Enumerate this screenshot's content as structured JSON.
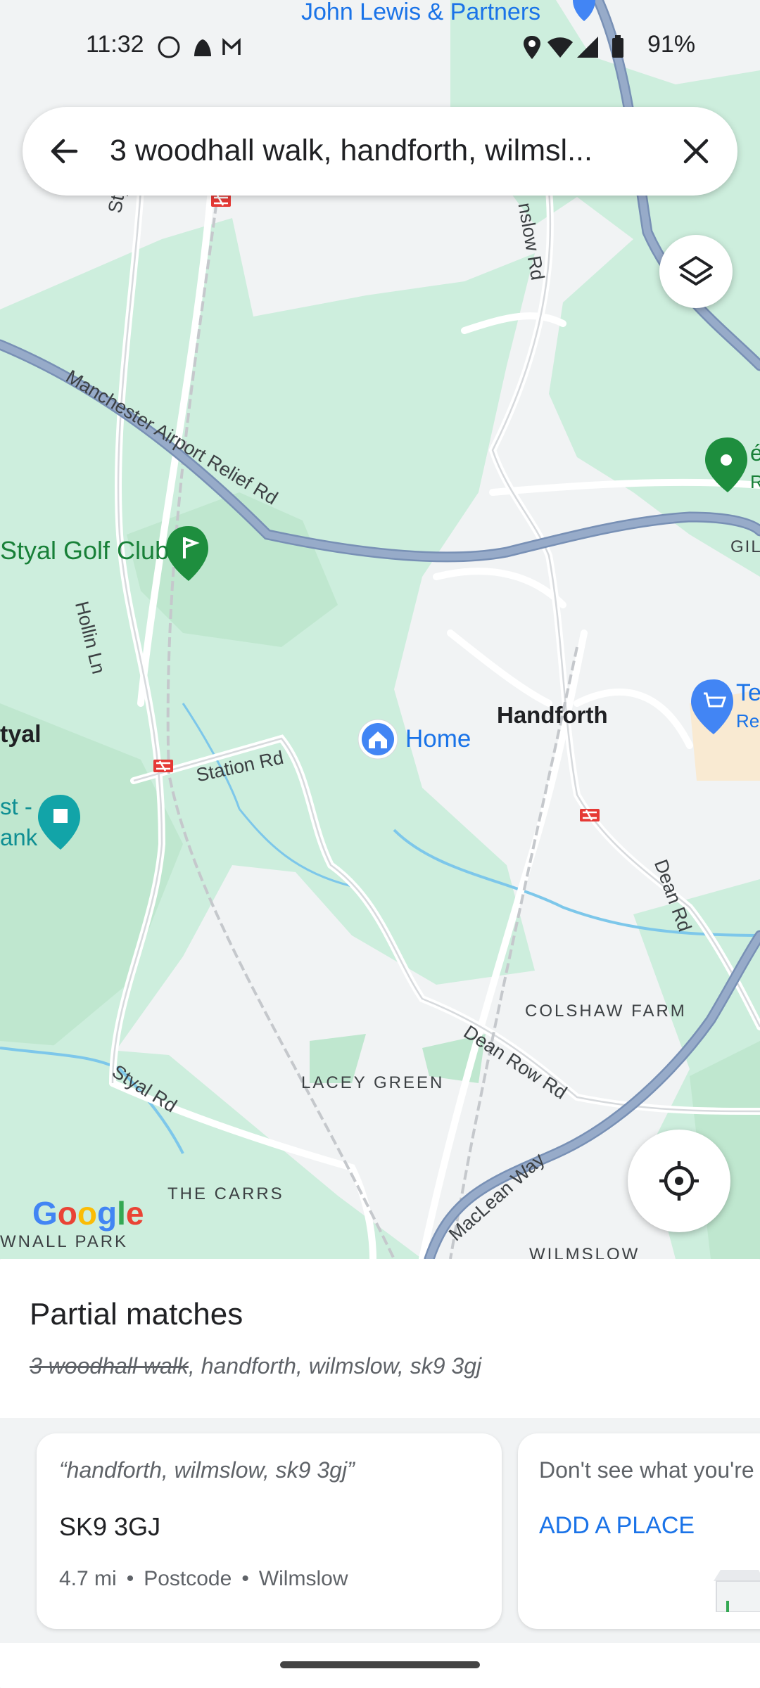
{
  "status_bar": {
    "time": "11:32",
    "battery": "91%",
    "notification_icons": [
      "whatsapp-icon",
      "snapchat-icon",
      "gmail-icon"
    ],
    "system_icons": [
      "location-icon",
      "wifi-icon",
      "signal-icon",
      "battery-icon"
    ]
  },
  "search": {
    "query": "3 woodhall walk, handforth, wilmsl..."
  },
  "map": {
    "places": {
      "top_store": "John Lewis & Partners",
      "golf": "Styal Golf Club",
      "home": "Home",
      "town": "Handforth",
      "styal": "tyal",
      "trust_line1": "st -",
      "trust_line2": "ank",
      "tesco_line1": "Te",
      "tesco_line2": "Re",
      "right_pin_line1": "é",
      "right_pin_line2": "R",
      "gil": "GIL"
    },
    "roads": {
      "styal_rd_top": "Styal Rd",
      "wilmslow_rd": "nslow Rd",
      "airport_relief": "Manchester Airport Relief Rd",
      "hollin_ln": "Hollin Ln",
      "station_rd": "Station Rd",
      "dean_rd": "Dean Rd",
      "dean_row_rd": "Dean Row Rd",
      "styal_rd_bottom": "Styal Rd",
      "maclean_way": "MacLean Way"
    },
    "areas": {
      "colshaw_farm": "COLSHAW FARM",
      "lacey_green": "LACEY GREEN",
      "the_carrs": "THE CARRS",
      "wilmslow": "WILMSLOW",
      "wnall_park": "WNALL PARK"
    },
    "logo": "Google",
    "colors": {
      "land": "#f1f3f4",
      "park": "#cdeedd",
      "park_dark": "#bfe7cf",
      "motorway": "#8a9fbf",
      "water": "#7dc7ea",
      "pin_green": "#1e8e3e",
      "pin_blue": "#4285f4"
    }
  },
  "sheet": {
    "title": "Partial matches",
    "sub_strike": "3 woodhall walk",
    "sub_rest": ", handforth, wilmslow, sk9 3gj"
  },
  "results": [
    {
      "quote": "“handforth, wilmslow, sk9 3gj”",
      "title": "SK9 3GJ",
      "distance": "4.7 mi",
      "type": "Postcode",
      "locality": "Wilmslow"
    }
  ],
  "add_place_card": {
    "prompt": "Don't see what you're",
    "action": "ADD A PLACE"
  }
}
